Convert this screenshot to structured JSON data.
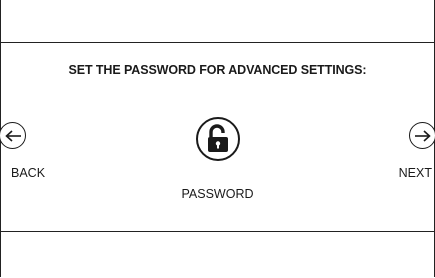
{
  "prompt": {
    "title": "SET THE PASSWORD FOR ADVANCED SETTINGS:"
  },
  "nav": {
    "back_label": "BACK",
    "next_label": "NEXT",
    "back_icon": "arrow-left-circle-icon",
    "next_icon": "arrow-right-circle-icon"
  },
  "password": {
    "label": "PASSWORD",
    "icon": "unlocked-padlock-icon"
  },
  "colors": {
    "background": "#ffffff",
    "foreground": "#1a1a1a",
    "border": "#222222"
  }
}
